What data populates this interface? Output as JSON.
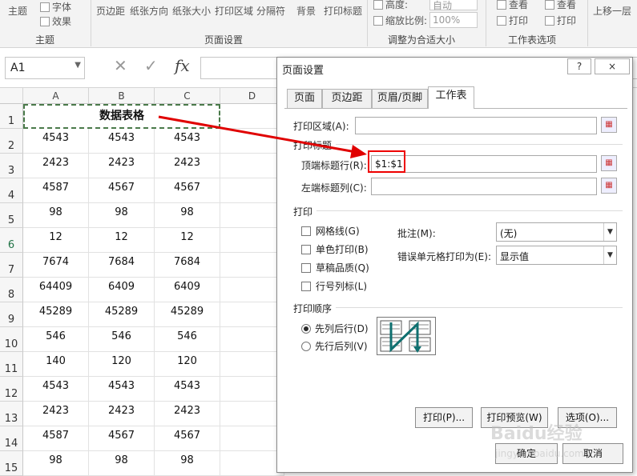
{
  "ribbon": {
    "theme": "主题",
    "font": "字体",
    "effects": "效果",
    "margins": "页边距",
    "orientation": "纸张方向",
    "size": "纸张大小",
    "print_area": "打印区域",
    "breaks": "分隔符",
    "background": "背景",
    "print_titles": "打印标题",
    "height": "高度:",
    "height_val": "自动",
    "scale": "缩放比例:",
    "scale_val": "100%",
    "gridlines_view": "查看",
    "gridlines_print": "打印",
    "headings_view": "查看",
    "headings_print": "打印",
    "bring_forward": "上移一层",
    "group_theme": "主题",
    "group_page_setup": "页面设置",
    "group_scale": "调整为合适大小",
    "group_sheet_options": "工作表选项"
  },
  "formula_bar": {
    "name_box": "A1",
    "fx": "fx"
  },
  "sheet": {
    "columns": [
      "A",
      "B",
      "C",
      "D"
    ],
    "title": "数据表格",
    "row_numbers": [
      "1",
      "2",
      "3",
      "4",
      "5",
      "6",
      "7",
      "8",
      "9",
      "10",
      "11",
      "12",
      "13",
      "14",
      "15"
    ],
    "rows": [
      [
        "4543",
        "4543",
        "4543"
      ],
      [
        "2423",
        "2423",
        "2423"
      ],
      [
        "4587",
        "4567",
        "4567"
      ],
      [
        "98",
        "98",
        "98"
      ],
      [
        "12",
        "12",
        "12"
      ],
      [
        "7674",
        "7684",
        "7684"
      ],
      [
        "64409",
        "6409",
        "6409"
      ],
      [
        "45289",
        "45289",
        "45289"
      ],
      [
        "546",
        "546",
        "546"
      ],
      [
        "140",
        "120",
        "120"
      ],
      [
        "4543",
        "4543",
        "4543"
      ],
      [
        "2423",
        "2423",
        "2423"
      ],
      [
        "4587",
        "4567",
        "4567"
      ],
      [
        "98",
        "98",
        "98"
      ]
    ]
  },
  "dialog": {
    "title": "页面设置",
    "help": "?",
    "close": "×",
    "tabs": [
      "页面",
      "页边距",
      "页眉/页脚",
      "工作表"
    ],
    "print_area_label": "打印区域(A):",
    "print_titles_section": "打印标题",
    "rows_repeat_label": "顶端标题行(R):",
    "rows_repeat_value": "$1:$1",
    "cols_repeat_label": "左端标题列(C):",
    "print_section": "打印",
    "gridlines": "网格线(G)",
    "black_white": "单色打印(B)",
    "draft": "草稿品质(Q)",
    "row_col_headings": "行号列标(L)",
    "comments_label": "批注(M):",
    "comments_value": "(无)",
    "errors_label": "错误单元格打印为(E):",
    "errors_value": "显示值",
    "order_section": "打印顺序",
    "down_then_over": "先列后行(D)",
    "over_then_down": "先行后列(V)",
    "print_button": "打印(P)...",
    "preview_button": "打印预览(W)",
    "options_button": "选项(O)...",
    "ok_button": "确定",
    "cancel_button": "取消"
  },
  "watermark": {
    "brand": "Baidu经验",
    "url": "jingyan.baidu.com"
  },
  "colors": {
    "annotation_red": "#e00000",
    "ribbon_bg": "#f3f3f3",
    "selected_row_header": "#217346"
  }
}
